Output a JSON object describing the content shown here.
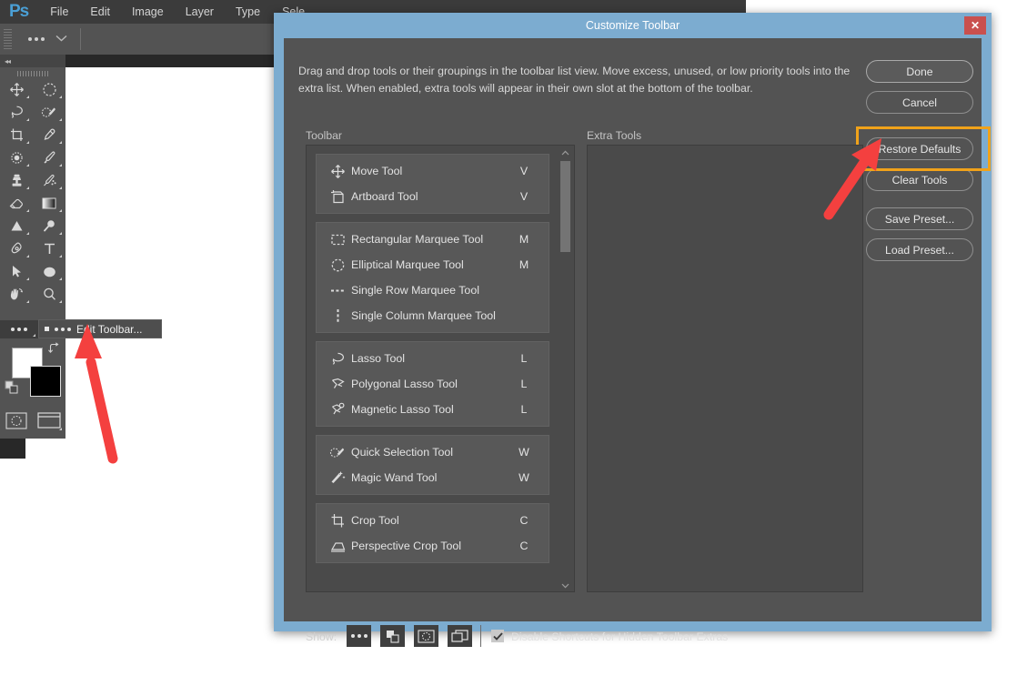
{
  "app": {
    "logo": "Ps",
    "menus": [
      "File",
      "Edit",
      "Image",
      "Layer",
      "Type",
      "Sele"
    ],
    "options_bar": {
      "overflow_icon": "ellipsis-icon",
      "chevron": "⌄"
    }
  },
  "tools_panel": {
    "collapse_icon": "◂◂",
    "tools": [
      {
        "name": "move-tool",
        "icon": "move"
      },
      {
        "name": "elliptical-marquee-tool",
        "icon": "ellipse-marquee"
      },
      {
        "name": "lasso-tool",
        "icon": "lasso"
      },
      {
        "name": "quick-selection-tool",
        "icon": "quick-select"
      },
      {
        "name": "crop-tool",
        "icon": "crop"
      },
      {
        "name": "eyedropper-tool",
        "icon": "eyedropper"
      },
      {
        "name": "spot-healing-brush-tool",
        "icon": "healing"
      },
      {
        "name": "brush-tool",
        "icon": "brush"
      },
      {
        "name": "clone-stamp-tool",
        "icon": "stamp"
      },
      {
        "name": "history-brush-tool",
        "icon": "history-brush"
      },
      {
        "name": "eraser-tool",
        "icon": "eraser"
      },
      {
        "name": "gradient-tool",
        "icon": "gradient"
      },
      {
        "name": "blur-tool",
        "icon": "triangle"
      },
      {
        "name": "dodge-tool",
        "icon": "dodge"
      },
      {
        "name": "pen-tool",
        "icon": "pen"
      },
      {
        "name": "type-tool",
        "icon": "type"
      },
      {
        "name": "path-selection-tool",
        "icon": "arrow-pointer"
      },
      {
        "name": "ellipse-tool",
        "icon": "ellipse-filled"
      },
      {
        "name": "hand-tool",
        "icon": "hand-rotate"
      },
      {
        "name": "zoom-tool",
        "icon": "magnifier"
      }
    ],
    "extra_row_icon": "ellipsis-icon",
    "flyout": {
      "bullet": "square-bullet",
      "dots_icon": "ellipsis-icon",
      "label": "Edit Toolbar..."
    },
    "colors": {
      "foreground": "#ffffff",
      "background": "#000000",
      "swap_icon": "swap-arrows-icon",
      "default_icon": "default-colors-icon",
      "quick_mask_icon": "quick-mask-icon",
      "screen_mode_icon": "screen-mode-icon"
    }
  },
  "dialog": {
    "title": "Customize Toolbar",
    "close_label": "✕",
    "intro": "Drag and drop tools or their groupings in the toolbar list view. Move excess, unused, or low priority tools into the extra list. When enabled, extra tools will appear in their own slot at the bottom of the toolbar.",
    "buttons": {
      "done": "Done",
      "cancel": "Cancel",
      "restore_defaults": "Restore Defaults",
      "clear_tools": "Clear Tools",
      "save_preset": "Save Preset...",
      "load_preset": "Load Preset..."
    },
    "highlight_color": "#f0a21a",
    "arrow_color": "#f4403f",
    "columns": {
      "toolbar": "Toolbar",
      "extra_tools": "Extra Tools"
    },
    "tool_groups": [
      {
        "tools": [
          {
            "name": "Move Tool",
            "key": "V",
            "icon": "move-icon"
          },
          {
            "name": "Artboard Tool",
            "key": "V",
            "icon": "artboard-icon"
          }
        ]
      },
      {
        "tools": [
          {
            "name": "Rectangular Marquee Tool",
            "key": "M",
            "icon": "rect-marquee-icon"
          },
          {
            "name": "Elliptical Marquee Tool",
            "key": "M",
            "icon": "ellipse-marquee-icon"
          },
          {
            "name": "Single Row Marquee Tool",
            "key": "",
            "icon": "single-row-marquee-icon"
          },
          {
            "name": "Single Column Marquee Tool",
            "key": "",
            "icon": "single-column-marquee-icon"
          }
        ]
      },
      {
        "tools": [
          {
            "name": "Lasso Tool",
            "key": "L",
            "icon": "lasso-icon"
          },
          {
            "name": "Polygonal Lasso Tool",
            "key": "L",
            "icon": "polygonal-lasso-icon"
          },
          {
            "name": "Magnetic Lasso Tool",
            "key": "L",
            "icon": "magnetic-lasso-icon"
          }
        ]
      },
      {
        "tools": [
          {
            "name": "Quick Selection Tool",
            "key": "W",
            "icon": "quick-selection-icon"
          },
          {
            "name": "Magic Wand Tool",
            "key": "W",
            "icon": "magic-wand-icon"
          }
        ]
      },
      {
        "tools": [
          {
            "name": "Crop Tool",
            "key": "C",
            "icon": "crop-icon"
          },
          {
            "name": "Perspective Crop Tool",
            "key": "C",
            "icon": "perspective-crop-icon"
          }
        ]
      }
    ],
    "scrollbar": {
      "up_icon": "chevron-up-icon",
      "down_icon": "chevron-down-icon"
    },
    "footer": {
      "show_label": "Show:",
      "show_buttons": [
        {
          "name": "show-extras-button",
          "icon": "ellipsis-icon"
        },
        {
          "name": "show-fill-color-button",
          "icon": "fill-color-icon"
        },
        {
          "name": "show-quick-mask-button",
          "icon": "quick-mask-icon"
        },
        {
          "name": "show-screen-mode-button",
          "icon": "screen-mode-icon"
        }
      ],
      "checkbox_label": "Disable Shortcuts for Hidden Toolbar Extras",
      "checkbox_checked": true
    }
  }
}
